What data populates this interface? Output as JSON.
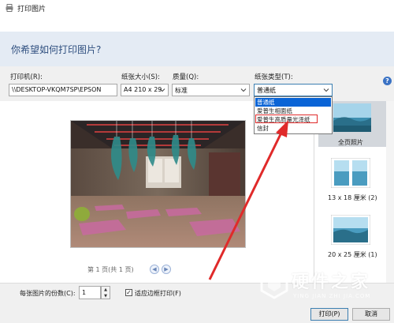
{
  "window": {
    "title": "打印图片",
    "icon": "printer-icon"
  },
  "header": {
    "question": "你希望如何打印图片?"
  },
  "settings": {
    "printer": {
      "label": "打印机(R):",
      "value": "\\\\DESKTOP-VKQM7SP\\EPSON"
    },
    "paper_size": {
      "label": "纸张大小(S):",
      "value": "A4 210 x 29"
    },
    "quality": {
      "label": "质量(Q):",
      "value": "标准"
    },
    "paper_type": {
      "label": "纸张类型(T):",
      "value": "普通纸",
      "options": [
        "普通纸",
        "爱普生相面纸",
        "爱普生高质量光泽纸",
        "信封"
      ],
      "selected_index": 0,
      "highlighted_index": 2
    }
  },
  "preview": {
    "pager_text": "第 1 页(共 1 页)"
  },
  "layouts": [
    {
      "label": "全页照片",
      "selected": true
    },
    {
      "label": "13 x 18 厘米 (2)",
      "selected": false
    },
    {
      "label": "20 x 25 厘米 (1)",
      "selected": false
    }
  ],
  "bottom": {
    "copies_label": "每张图片的份数(C):",
    "copies_value": "1",
    "fit_label": "适应边框打印(F)",
    "fit_checked": true,
    "print_label": "打印(P)",
    "cancel_label": "取消"
  },
  "watermark": {
    "main": "硬件之家",
    "sub": "YING JIAN ZHI JIA.COM"
  },
  "colors": {
    "accent": "#0a64d6",
    "annotation": "#e02a2a",
    "header_bg": "#e4ebf4",
    "header_text": "#2f4f7f"
  }
}
